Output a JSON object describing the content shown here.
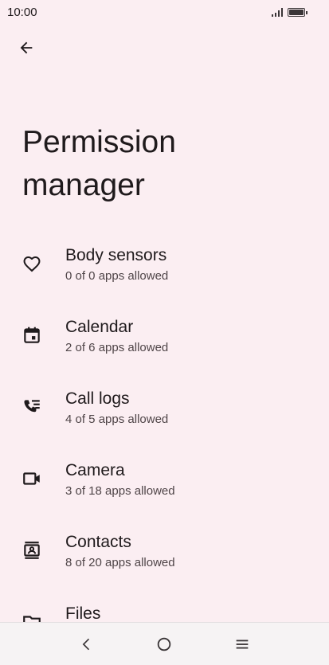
{
  "status_bar": {
    "time": "10:00"
  },
  "header": {
    "back_icon": "arrow-back-icon",
    "title": "Permission\nmanager"
  },
  "permissions": [
    {
      "icon": "heart-icon",
      "label": "Body sensors",
      "summary": "0 of 0 apps allowed"
    },
    {
      "icon": "calendar-icon",
      "label": "Calendar",
      "summary": "2 of 6 apps allowed"
    },
    {
      "icon": "call-log-icon",
      "label": "Call logs",
      "summary": "4 of 5 apps allowed"
    },
    {
      "icon": "camera-icon",
      "label": "Camera",
      "summary": "3 of 18 apps allowed"
    },
    {
      "icon": "contacts-icon",
      "label": "Contacts",
      "summary": "8 of 20 apps allowed"
    },
    {
      "icon": "folder-icon",
      "label": "Files",
      "summary": ""
    }
  ],
  "nav_bar": {
    "back": "back-chevron-icon",
    "home": "home-circle-icon",
    "menu": "menu-lines-icon"
  }
}
